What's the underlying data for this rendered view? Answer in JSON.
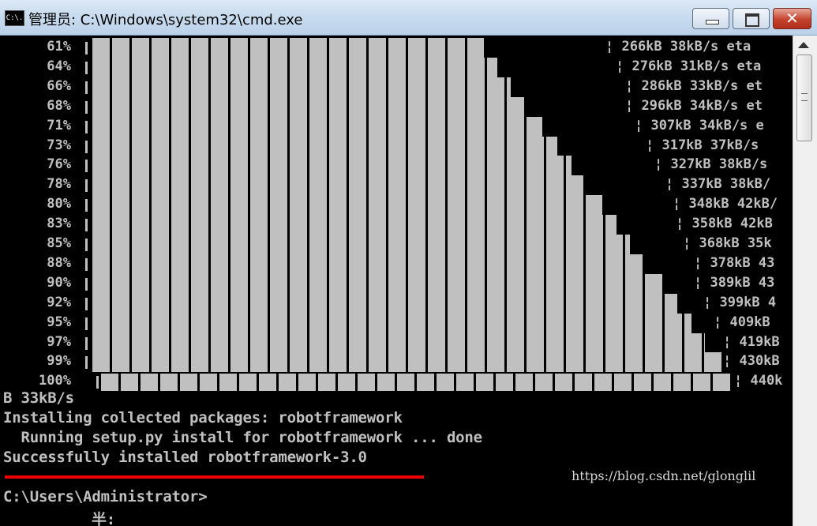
{
  "window": {
    "title": "管理员: C:\\Windows\\system32\\cmd.exe",
    "icon_text": "C:\\."
  },
  "titlebar_buttons": {
    "minimize_icon": "minimize-icon",
    "maximize_icon": "maximize-icon",
    "close_glyph": "✕"
  },
  "progress_rows": [
    {
      "pct": "61%",
      "tail": "¦ 266kB 38kB/s eta"
    },
    {
      "pct": "64%",
      "tail": "¦ 276kB 31kB/s eta"
    },
    {
      "pct": "66%",
      "tail": "¦ 286kB 33kB/s et"
    },
    {
      "pct": "68%",
      "tail": "¦ 296kB 34kB/s et"
    },
    {
      "pct": "71%",
      "tail": "¦ 307kB 34kB/s e"
    },
    {
      "pct": "73%",
      "tail": "¦ 317kB 37kB/s"
    },
    {
      "pct": "76%",
      "tail": "¦ 327kB 38kB/s"
    },
    {
      "pct": "78%",
      "tail": "¦ 337kB 38kB/"
    },
    {
      "pct": "80%",
      "tail": "¦ 348kB 42kB/"
    },
    {
      "pct": "83%",
      "tail": "¦ 358kB 42kB"
    },
    {
      "pct": "85%",
      "tail": "¦ 368kB 35k"
    },
    {
      "pct": "88%",
      "tail": "¦ 378kB 43"
    },
    {
      "pct": "90%",
      "tail": "¦ 389kB 43"
    },
    {
      "pct": "92%",
      "tail": "¦ 399kB 4"
    },
    {
      "pct": "95%",
      "tail": "¦ 409kB"
    },
    {
      "pct": "97%",
      "tail": "¦ 419kB"
    },
    {
      "pct": "99%",
      "tail": "¦ 430kB"
    },
    {
      "pct": "100%",
      "tail": "¦ 440k"
    }
  ],
  "console_lines": {
    "wrap": "B 33kB/s",
    "installing": "Installing collected packages: robotframework",
    "running": "  Running setup.py install for robotframework ... done",
    "success": "Successfully installed robotframework-3.0",
    "prompt": "C:\\Users\\Administrator>",
    "ime": "半:"
  },
  "watermark": "https://blog.csdn.net/glonglil",
  "colors": {
    "console_text": "#c0c0c0",
    "underline": "#e00000"
  }
}
